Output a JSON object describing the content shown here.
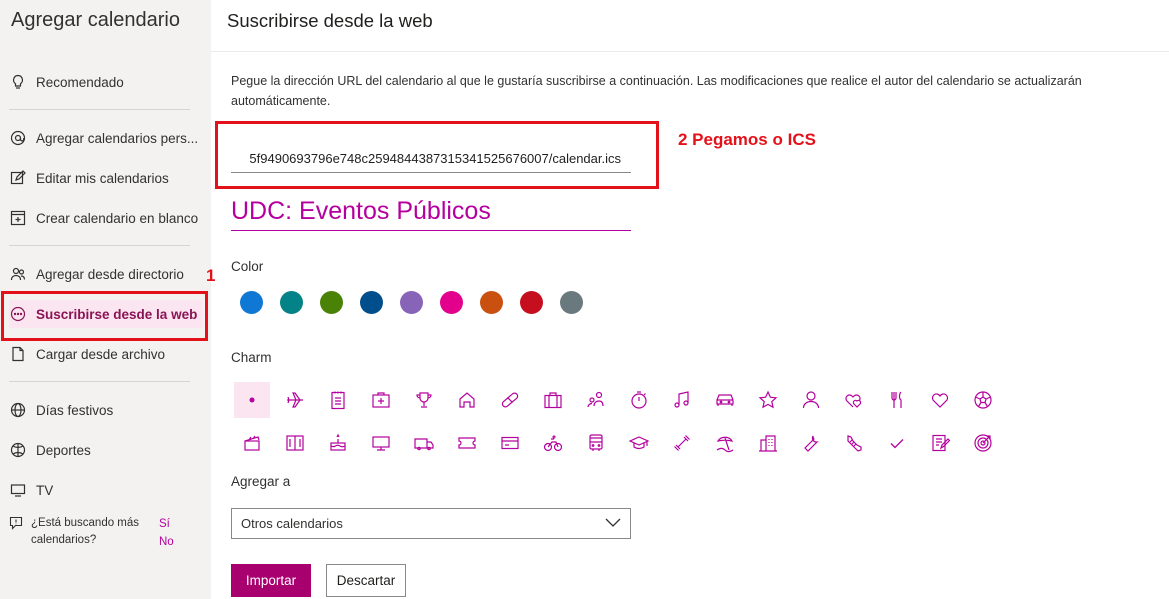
{
  "sidebar": {
    "title": "Agregar calendario",
    "items": [
      {
        "label": "Recomendado",
        "icon": "lightbulb-icon"
      },
      {
        "label": "Agregar calendarios pers...",
        "icon": "at-icon"
      },
      {
        "label": "Editar mis calendarios",
        "icon": "edit-icon"
      },
      {
        "label": "Crear calendario en blanco",
        "icon": "calendar-add-icon"
      },
      {
        "label": "Agregar desde directorio",
        "icon": "people-icon"
      },
      {
        "label": "Suscribirse desde la web",
        "icon": "more-circle-icon"
      },
      {
        "label": "Cargar desde archivo",
        "icon": "file-upload-icon"
      },
      {
        "label": "Días festivos",
        "icon": "globe-icon"
      },
      {
        "label": "Deportes",
        "icon": "ball-icon"
      },
      {
        "label": "TV",
        "icon": "tv-icon"
      }
    ],
    "help_text": "¿Está buscando más calendarios?",
    "help_yes": "Sí",
    "help_no": "No"
  },
  "main": {
    "title": "Suscribirse desde la web",
    "description": "Pegue la dirección URL del calendario al que le gustaría suscribirse a continuación. Las modificaciones que realice el autor del calendario se actualizarán automáticamente.",
    "url_value": "5f9490693796e748c259484438731534152567600​7/calendar.ics",
    "calendar_name": "UDC: Eventos Públicos",
    "color_label": "Color",
    "colors": [
      "#0f78d4",
      "#038387",
      "#498205",
      "#004e8c",
      "#8764b8",
      "#e3008c",
      "#ca5010",
      "#c50f1f",
      "#69797e"
    ],
    "charm_label": "Charm",
    "add_to_label": "Agregar a",
    "add_to_value": "Otros calendarios",
    "import_label": "Importar",
    "discard_label": "Descartar"
  },
  "annotations": {
    "step1": "1",
    "step2": "2 Pegamos o ICS"
  }
}
